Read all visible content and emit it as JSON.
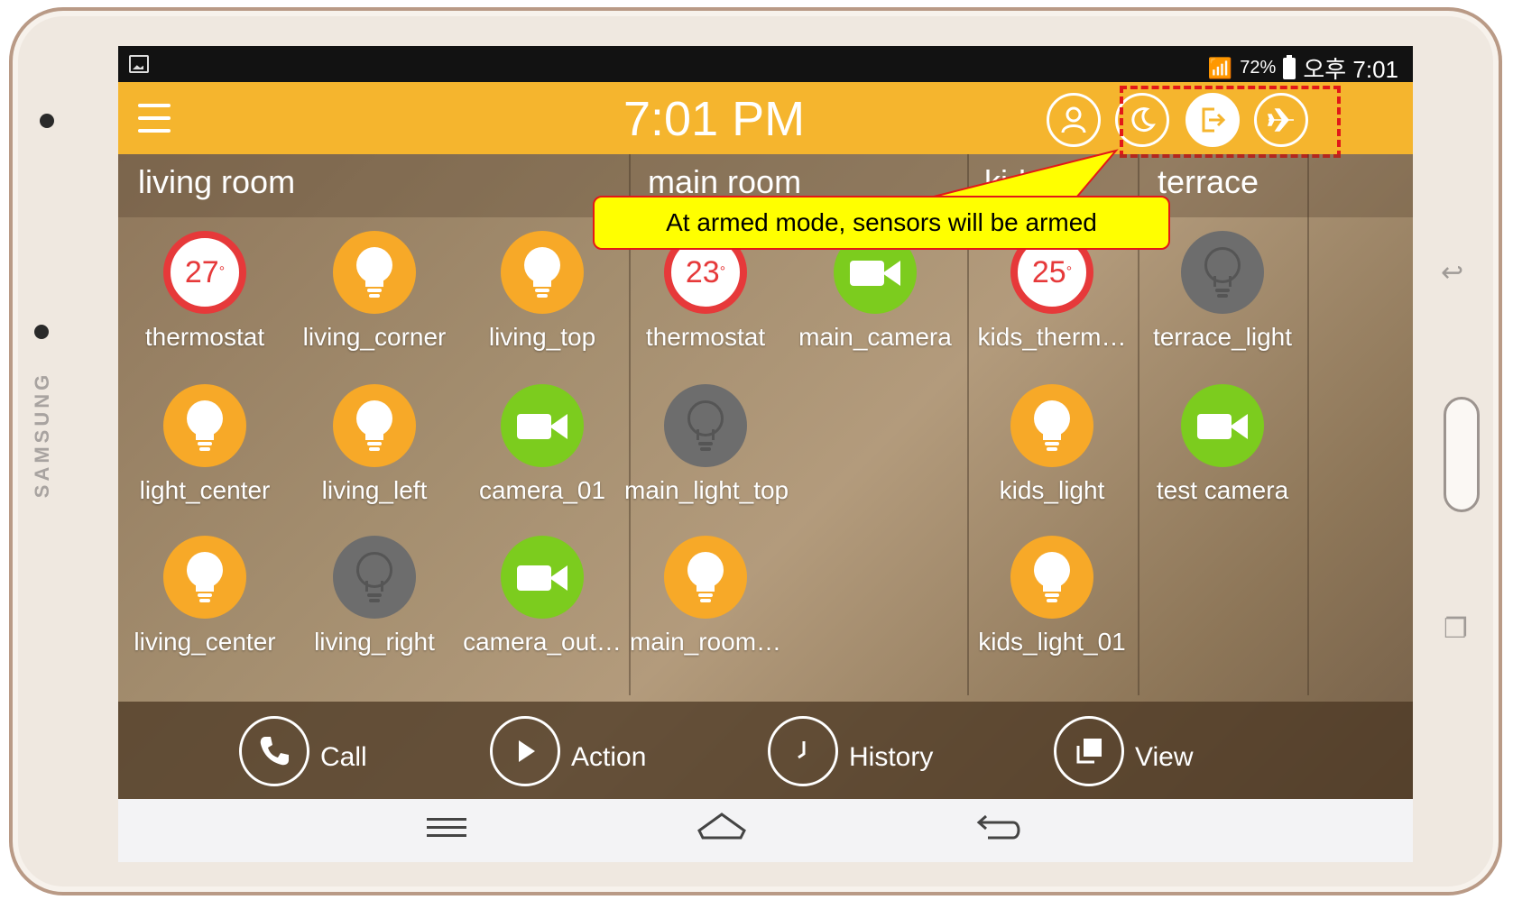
{
  "device": {
    "brand": "SAMSUNG"
  },
  "status_bar": {
    "battery_pct": "72%",
    "time": "오후 7:01"
  },
  "top_bar": {
    "time": "7:01 PM"
  },
  "rooms": [
    {
      "name": "living room"
    },
    {
      "name": "main room"
    },
    {
      "name": "kids room",
      "visible_text": "kid m"
    },
    {
      "name": "terrace"
    }
  ],
  "devices": {
    "living": [
      {
        "label": "thermostat",
        "type": "thermostat",
        "value": "27"
      },
      {
        "label": "living_corner",
        "type": "light",
        "state": "on"
      },
      {
        "label": "living_top",
        "type": "light",
        "state": "on"
      },
      {
        "label": "light_center",
        "type": "light",
        "state": "on"
      },
      {
        "label": "living_left",
        "type": "light",
        "state": "on"
      },
      {
        "label": "camera_01",
        "type": "camera"
      },
      {
        "label": "living_center",
        "type": "light",
        "state": "on"
      },
      {
        "label": "living_right",
        "type": "light",
        "state": "off"
      },
      {
        "label": "camera_out…",
        "type": "camera"
      }
    ],
    "main": [
      {
        "label": "thermostat",
        "type": "thermostat",
        "value": "23"
      },
      {
        "label": "main_camera",
        "type": "camera"
      },
      {
        "label": "main_light_top",
        "type": "light",
        "state": "off"
      },
      {
        "label": "main_room…",
        "type": "light",
        "state": "on"
      }
    ],
    "kids": [
      {
        "label": "kids_therm…",
        "type": "thermostat",
        "value": "25"
      },
      {
        "label": "kids_light",
        "type": "light",
        "state": "on"
      },
      {
        "label": "kids_light_01",
        "type": "light",
        "state": "on"
      }
    ],
    "terrace": [
      {
        "label": "terrace_light",
        "type": "light",
        "state": "off"
      },
      {
        "label": "test camera",
        "type": "camera"
      }
    ]
  },
  "callout": {
    "text": "At armed mode, sensors will be armed"
  },
  "action_bar": {
    "call": "Call",
    "action": "Action",
    "history": "History",
    "view": "View"
  },
  "colors": {
    "accent": "#f5b52e",
    "light_on": "#f7a928",
    "light_off": "#6d6d6d",
    "camera": "#7ccc1e",
    "thermo_ring": "#e6393a",
    "callout_bg": "#ffff00",
    "highlight": "#e21818"
  }
}
